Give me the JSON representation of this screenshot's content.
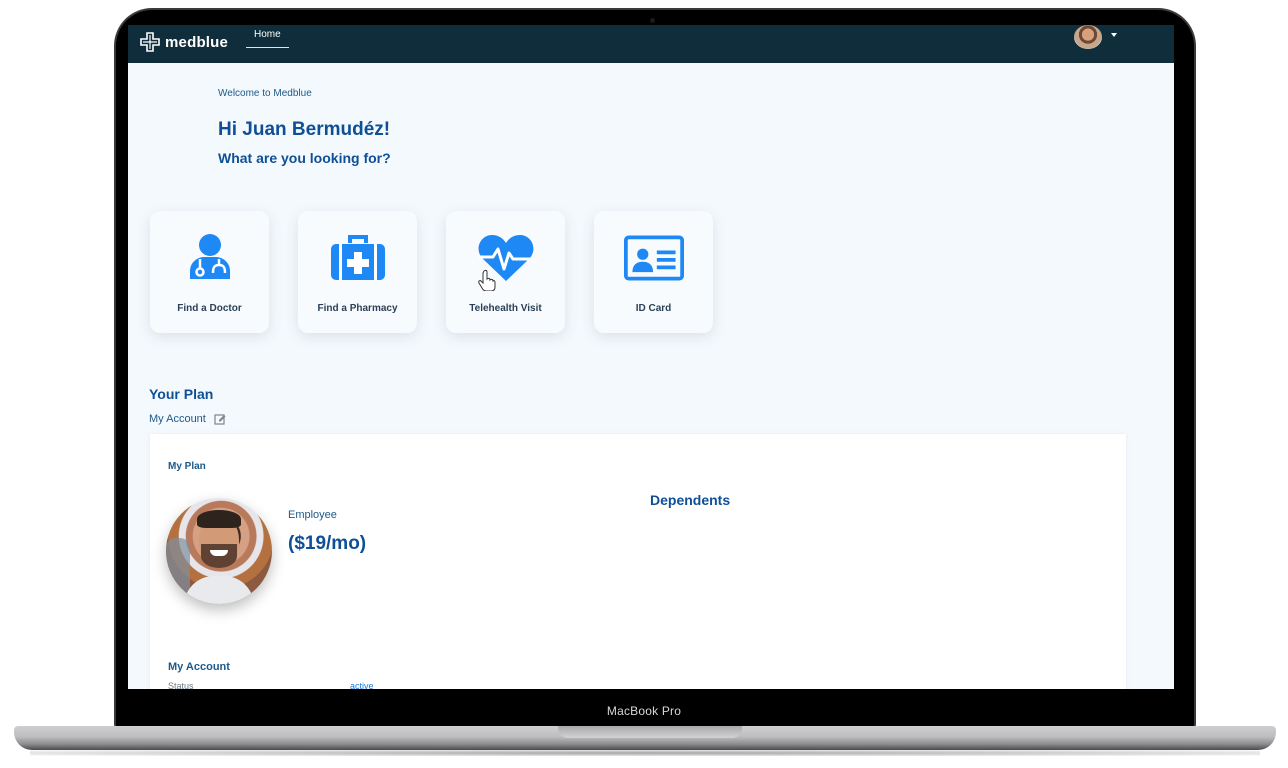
{
  "device": {
    "label": "MacBook Pro"
  },
  "navbar": {
    "brand": "medblue",
    "items": [
      {
        "label": "Home",
        "active": true
      }
    ],
    "colors": {
      "background": "#0f2d3b",
      "text": "#ffffff"
    }
  },
  "hero": {
    "welcome": "Welcome to Medblue",
    "greeting": "Hi Juan Bermudéz!",
    "question": "What are you looking for?"
  },
  "quick_actions": [
    {
      "label": "Find a Doctor",
      "icon": "doctor-icon"
    },
    {
      "label": "Find a Pharmacy",
      "icon": "medical-kit-icon"
    },
    {
      "label": "Telehealth Visit",
      "icon": "heartbeat-icon"
    },
    {
      "label": "ID Card",
      "icon": "id-card-icon"
    }
  ],
  "plan": {
    "title": "Your Plan",
    "account_link": "My Account",
    "my_plan_label": "My Plan",
    "member_type": "Employee",
    "price": "($19/mo)",
    "dependents_title": "Dependents",
    "account_section": "My Account",
    "status_label": "Status",
    "status_value": "active"
  },
  "colors": {
    "accent": "#1e88f5",
    "heading": "#0f4f96",
    "screen_background": "#f4f9fd"
  }
}
